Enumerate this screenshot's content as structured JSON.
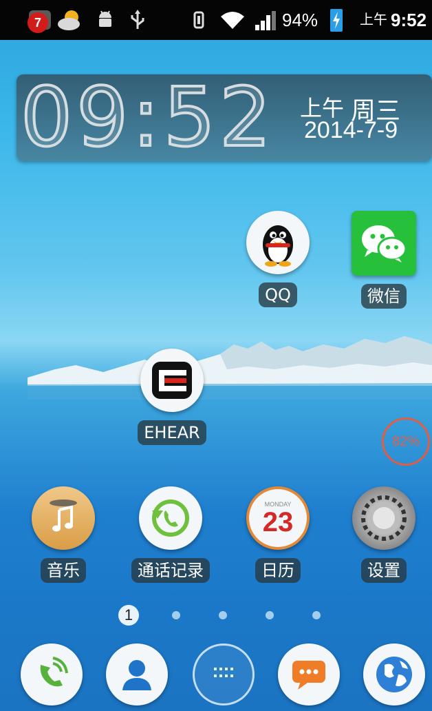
{
  "status_bar": {
    "notification_count": "7",
    "battery_percent": "94%",
    "ampm": "上午",
    "time": "9:52",
    "icons": [
      "notification-app-icon",
      "weather-icon",
      "android-debug-icon",
      "usb-icon",
      "vibrate-icon",
      "wifi-icon",
      "signal-icon",
      "battery-charging-icon"
    ]
  },
  "clock_widget": {
    "time": "09:52",
    "ampm": "上午",
    "weekday": "周三",
    "date": "2014-7-9"
  },
  "apps": {
    "qq": {
      "label": "QQ",
      "icon": "qq-penguin-icon"
    },
    "wechat": {
      "label": "微信",
      "icon": "wechat-icon"
    },
    "ehear": {
      "label": "EHEAR",
      "icon": "ehear-icon"
    },
    "music": {
      "label": "音乐",
      "icon": "music-icon"
    },
    "call_log": {
      "label": "通话记录",
      "icon": "call-log-icon"
    },
    "calendar": {
      "label": "日历",
      "icon": "calendar-icon",
      "month": "MONDAY",
      "day": "23"
    },
    "settings": {
      "label": "设置",
      "icon": "gear-icon"
    }
  },
  "floating_widget": {
    "text": "82%"
  },
  "page_indicator": {
    "current": "1",
    "total": 5
  },
  "dock": [
    "phone-icon",
    "contacts-icon",
    "app-drawer-icon",
    "messaging-icon",
    "browser-icon"
  ],
  "colors": {
    "status_bar": "#050505",
    "wechat_green": "#27c03a",
    "label_bg": "#28384a"
  }
}
